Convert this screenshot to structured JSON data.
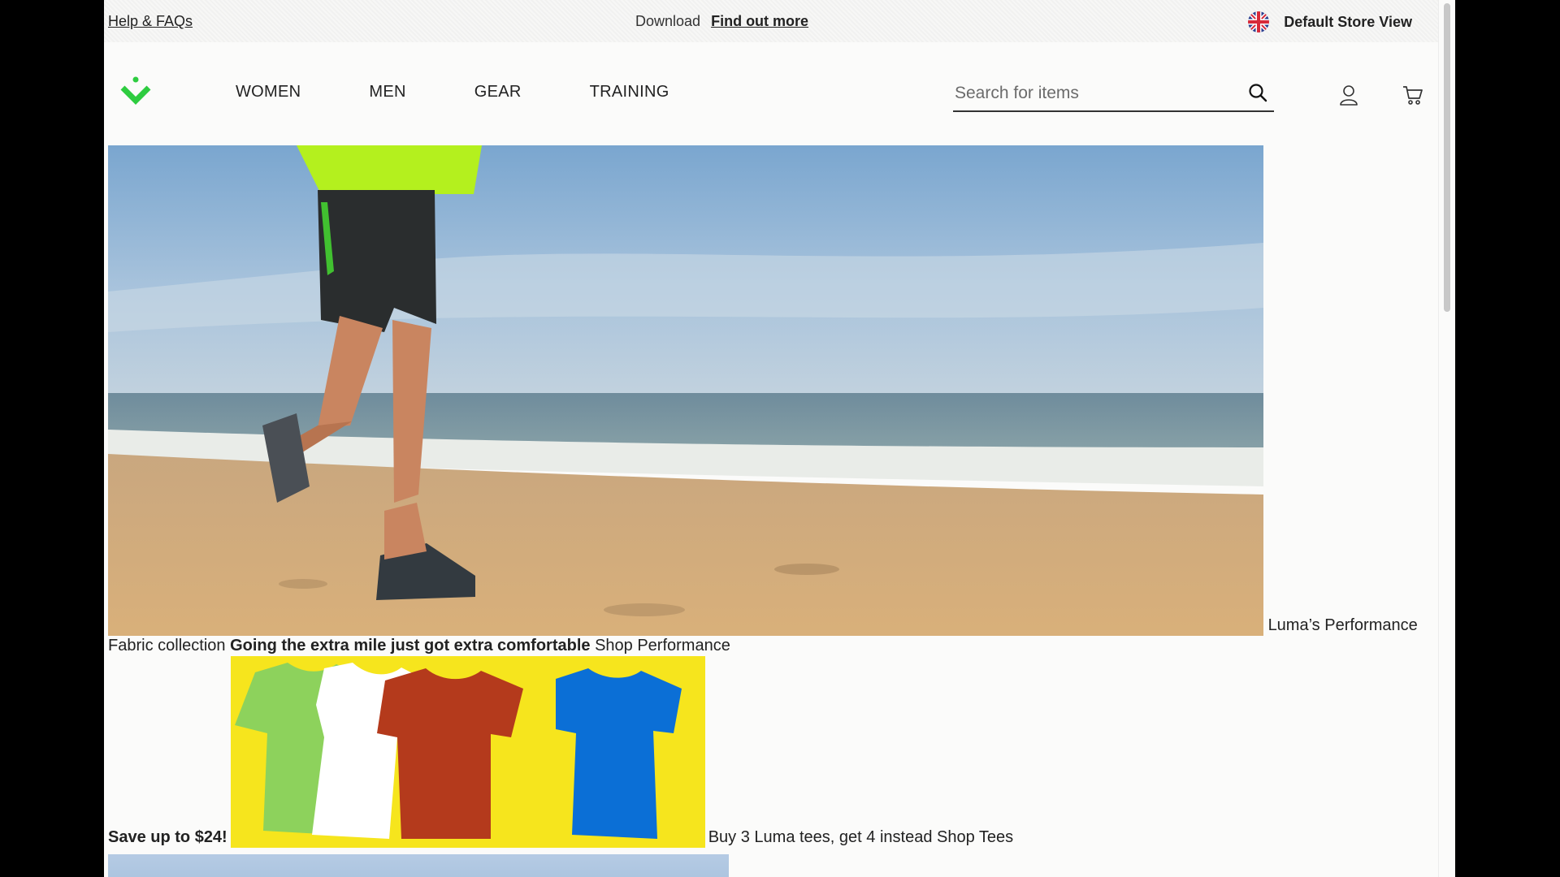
{
  "topbar": {
    "help_label": "Help & FAQs",
    "promo_text": "Download",
    "promo_link": "Find out more",
    "store_label": "Default Store View",
    "flag_icon": "uk-flag-icon"
  },
  "header": {
    "logo_icon": "luma-logo-icon",
    "nav": [
      "WOMEN",
      "MEN",
      "GEAR",
      "TRAINING"
    ],
    "search_placeholder": "Search for items",
    "icons": [
      "search-icon",
      "account-icon",
      "cart-icon"
    ]
  },
  "hero": {
    "caption_line": "Luma’s Performance Fabric collection",
    "headline": "Going the extra mile just got extra comfortable",
    "cta": "Shop Performance"
  },
  "tees": {
    "save_text": "Save up to $24!",
    "offer_text": "Buy 3 Luma tees, get 4 instead",
    "cta": "Shop Tees"
  },
  "colors": {
    "accent_green": "#2ecc40",
    "tees_background": "#f6e51d"
  }
}
